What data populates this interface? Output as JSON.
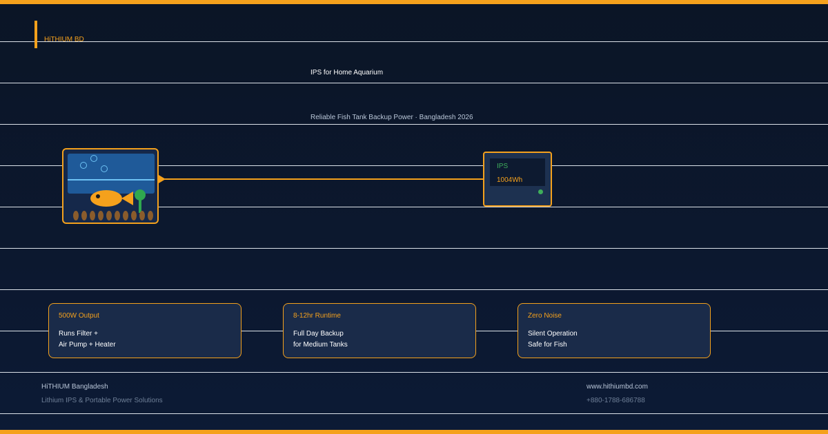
{
  "brand": "HiTHIUM BD",
  "title": "IPS for Home Aquarium",
  "subtitle": "Reliable Fish Tank Backup Power · Bangladesh 2026",
  "ips": {
    "label": "IPS",
    "capacity": "1004Wh"
  },
  "cards": [
    {
      "heading": "500W Output",
      "line1": "Runs Filter +",
      "line2": "Air Pump + Heater"
    },
    {
      "heading": "8-12hr Runtime",
      "line1": "Full Day Backup",
      "line2": "for Medium Tanks"
    },
    {
      "heading": "Zero Noise",
      "line1": "Silent Operation",
      "line2": "Safe for Fish"
    }
  ],
  "footer": {
    "company": "HiTHIUM Bangladesh",
    "tagline": "Lithium IPS & Portable Power Solutions",
    "website": "www.hithiumbd.com",
    "phone": "+880-1788-686788"
  },
  "colors": {
    "accent": "#f5a11c",
    "background": "#0b1526",
    "status_green": "#3fae5b"
  }
}
